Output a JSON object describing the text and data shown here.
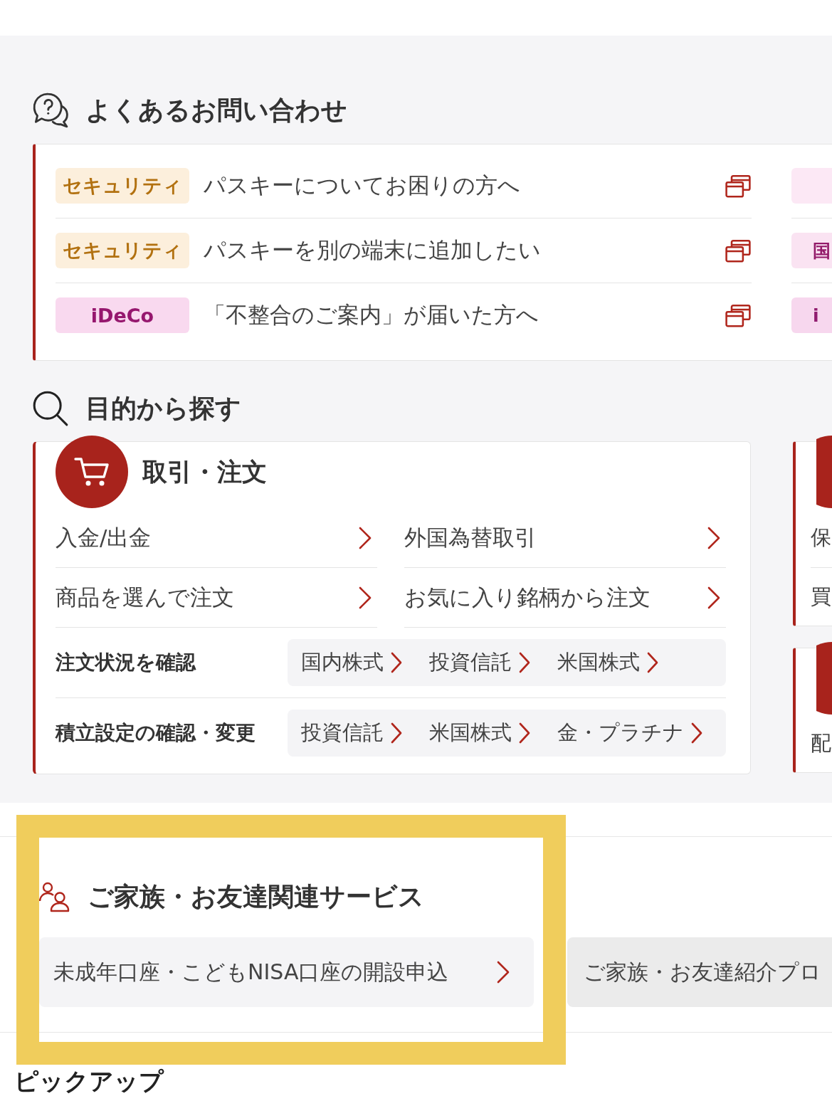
{
  "faq": {
    "title": "よくあるお問い合わせ",
    "columns": [
      {
        "items": [
          {
            "tag": {
              "text": "セキュリティ",
              "color": "#fcefdc"
            },
            "text": "パスキーについてお困りの方へ"
          },
          {
            "tag": {
              "text": "セキュリティ",
              "color": "#fcefdc"
            },
            "text": "パスキーを別の端末に追加したい"
          },
          {
            "tag": {
              "text": "iDeCo",
              "color": "#f9d9ef"
            },
            "text": "「不整合のご案内」が届いた方へ"
          }
        ]
      },
      {
        "items": [
          {
            "tag": {
              "color": "#fce8f5"
            }
          },
          {
            "tag": {
              "text": "国",
              "color": "#fae3f2"
            }
          },
          {
            "tag": {
              "text": "i",
              "color": "#f7d7ee"
            }
          }
        ]
      }
    ]
  },
  "search": {
    "title": "目的から探す",
    "columns": [
      {
        "cards": [
          {
            "title": "取引・注文",
            "links": [
              "入金/出金",
              "外国為替取引",
              "商品を選んで注文",
              "お気に入り銘柄から注文"
            ],
            "rows": [
              {
                "label": "注文状況を確認",
                "links": [
                  "国内株式",
                  "投資信託",
                  "米国株式"
                ]
              },
              {
                "label": "積立設定の確認・変更",
                "links": [
                  "投資信託",
                  "米国株式",
                  "金・プラチナ"
                ]
              }
            ]
          }
        ]
      },
      {
        "cards": [
          {
            "links": [
              "保",
              "買"
            ]
          },
          {
            "links": [
              "配"
            ]
          }
        ]
      }
    ]
  },
  "family": {
    "title": "ご家族・お友達関連サービス",
    "links": [
      {
        "text": "未成年口座・こどもNISA口座の開設申込",
        "arrow": true
      },
      {
        "text": "ご家族・お友達紹介プロ",
        "arrow": false
      }
    ]
  },
  "pickup": {
    "title": "ピックアップ"
  }
}
